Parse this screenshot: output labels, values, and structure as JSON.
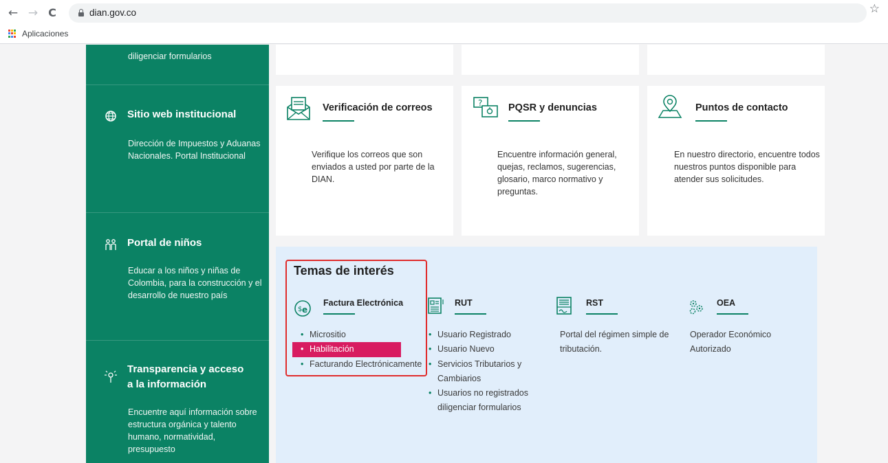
{
  "browser": {
    "back_icon": "←",
    "forward_icon": "→",
    "reload_icon": "C",
    "url": "dian.gov.co",
    "star_icon": "☆",
    "bookmarks_label": "Aplicaciones"
  },
  "sidebar": {
    "items": [
      {
        "title": "",
        "description": "diligenciar formularios"
      },
      {
        "title": "Sitio web institucional",
        "description": "Dirección de Impuestos y Aduanas Nacionales. Portal Institucional"
      },
      {
        "title": "Portal de niños",
        "description": "Educar a los niños y niñas de Colombia, para la construcción y el desarrollo de nuestro país"
      },
      {
        "title_line1": "Transparencia y acceso",
        "title_line2": "a la información",
        "description": "Encuentre aquí información sobre estructura orgánica y talento humano, normatividad, presupuesto"
      }
    ]
  },
  "cards": [
    {
      "title": "Verificación de correos",
      "description": "Verifique los correos que son enviados a usted por parte de la DIAN."
    },
    {
      "title": "PQSR y denuncias",
      "description": "Encuentre información general, quejas, reclamos, sugerencias, glosario, marco normativo y preguntas."
    },
    {
      "title": "Puntos de contacto",
      "description": "En nuestro directorio, encuentre todos nuestros puntos disponible para atender sus solicitudes."
    }
  ],
  "temas": {
    "title": "Temas de interés",
    "columns": [
      {
        "title": "Factura Electrónica",
        "items": [
          "Micrositio",
          "Habilitación",
          "Facturando Electrónicamente"
        ]
      },
      {
        "title": "RUT",
        "items": [
          "Usuario Registrado",
          "Usuario Nuevo",
          "Servicios Tributarios y",
          "Cambiarios",
          "Usuarios no registrados",
          "diligenciar formularios"
        ]
      },
      {
        "title": "RST",
        "text": "Portal del régimen simple de tributación."
      },
      {
        "title": "OEA",
        "text": "Operador Económico Autorizado"
      }
    ]
  },
  "colors": {
    "green": "#0b8264",
    "highlight": "#d81b60",
    "annotation": "#e02b2b",
    "temas_bg": "#e1eefb"
  }
}
